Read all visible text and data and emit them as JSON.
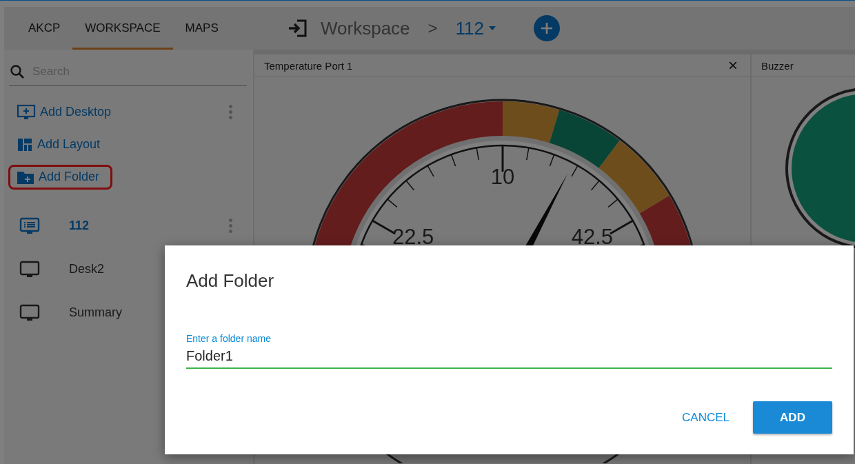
{
  "tabs": [
    {
      "label": "AKCP",
      "selected": false
    },
    {
      "label": "WORKSPACE",
      "selected": true
    },
    {
      "label": "MAPS",
      "selected": false
    }
  ],
  "search": {
    "placeholder": "Search"
  },
  "actions": [
    {
      "label": "Add Desktop",
      "kind": "desktop",
      "highlighted": false,
      "menu": true
    },
    {
      "label": "Add Layout",
      "kind": "layout",
      "highlighted": false,
      "menu": false
    },
    {
      "label": "Add Folder",
      "kind": "folder",
      "highlighted": true,
      "menu": false
    }
  ],
  "desktops": [
    {
      "label": "112",
      "kind": "list",
      "selected": true,
      "menu": true
    },
    {
      "label": "Desk2",
      "kind": "plain",
      "selected": false
    },
    {
      "label": "Summary",
      "kind": "plain",
      "selected": false
    }
  ],
  "breadcrumb": {
    "root": "Workspace",
    "separator": ">",
    "current": "112"
  },
  "widgets": [
    {
      "title": "Temperature Port 1",
      "kind": "gauge",
      "close": "×",
      "gauge_labels": [
        "10",
        "22.5",
        "42.5"
      ]
    },
    {
      "title": "Buzzer",
      "kind": "buzzer"
    }
  ],
  "dialog": {
    "title": "Add Folder",
    "field_label": "Enter a folder name",
    "value": "Folder1",
    "buttons": [
      {
        "label": "CANCEL",
        "kind": "text"
      },
      {
        "label": "ADD",
        "kind": "primary"
      }
    ]
  }
}
